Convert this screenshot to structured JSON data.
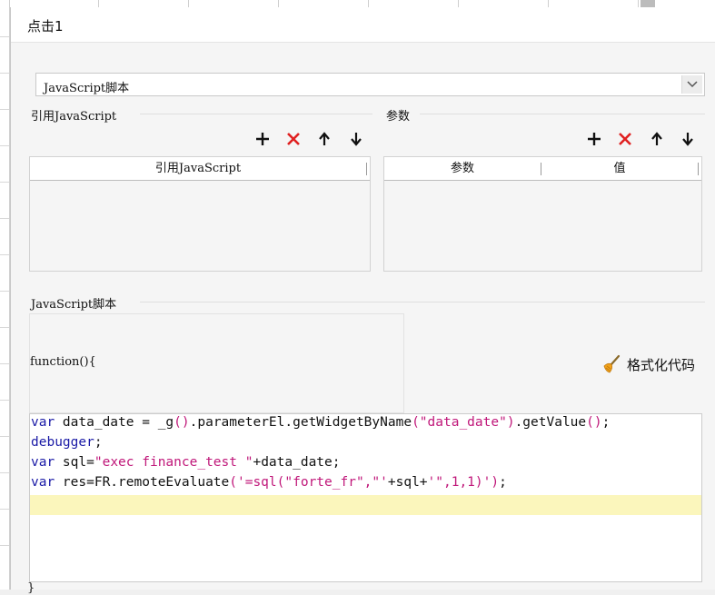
{
  "dialog": {
    "title": "点击1"
  },
  "script_type": {
    "selected": "JavaScript脚本"
  },
  "refs": {
    "section_label": "引用JavaScript",
    "column_header": "引用JavaScript"
  },
  "params": {
    "section_label": "参数",
    "columns": [
      "参数",
      "值"
    ]
  },
  "script": {
    "section_label": "JavaScript脚本",
    "function_header": "function(){",
    "format_button": "格式化代码",
    "code": {
      "l1": {
        "a": "var",
        "b": " data_date = _g",
        "c": "()",
        "d": ".parameterEl.getWidgetByName",
        "e": "(\"data_date\")",
        "f": ".getValue",
        "g": "()",
        "h": ";"
      },
      "l2": {
        "a": "debugger",
        "b": ";"
      },
      "l3": {
        "a": "var",
        "b": " sql=",
        "c": "\"exec finance_test \"",
        "d": "+data_date;"
      },
      "l4": {
        "a": "var",
        "b": " res=FR.remoteEvaluate",
        "c": "('=sql(\"forte_fr\",\"'",
        "d": "+sql+",
        "e": "'\",1,1)')",
        "f": ";"
      }
    },
    "closing": "}"
  },
  "colors": {
    "keyword": "#1a1aa6",
    "string": "#c0187a",
    "highlight": "#fbf6bc",
    "delete": "#e02020"
  }
}
